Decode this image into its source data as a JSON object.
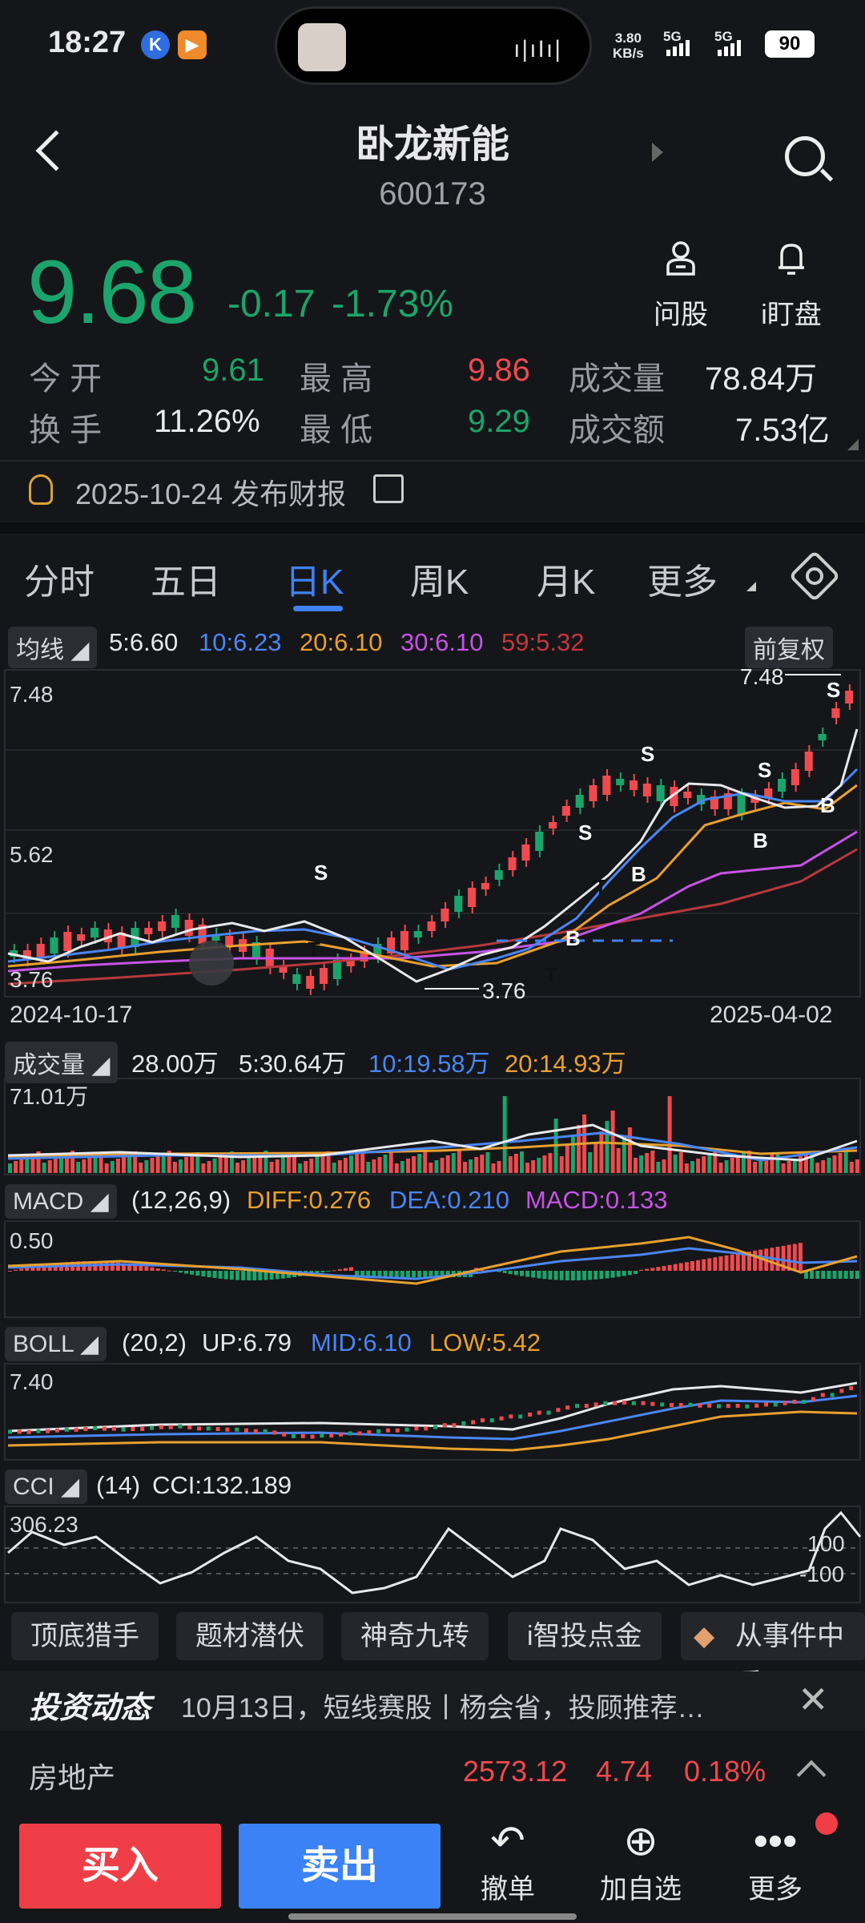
{
  "status_bar": {
    "time": "18:27",
    "speed_top": "3.80",
    "speed_bottom": "KB/s",
    "sig1": "5G",
    "sig2": "5G",
    "battery": "90"
  },
  "header": {
    "stock_name": "卧龙新能",
    "stock_code": "600173"
  },
  "quote": {
    "price": "9.68",
    "change": "-0.17",
    "change_pct": "-1.73%",
    "ask_label": "问股",
    "watch_label": "i盯盘"
  },
  "stats": {
    "open_label": "今  开",
    "open_value": "9.61",
    "high_label": "最  高",
    "high_value": "9.86",
    "volume_label": "成交量",
    "volume_value": "78.84万",
    "turnover_label": "换  手",
    "turnover_value": "11.26%",
    "low_label": "最  低",
    "low_value": "9.29",
    "amount_label": "成交额",
    "amount_value": "7.53亿"
  },
  "report": {
    "text": "2025-10-24 发布财报"
  },
  "tabs": [
    "分时",
    "五日",
    "日K",
    "周K",
    "月K",
    "更多"
  ],
  "ma": {
    "label": "均线",
    "ma5": "5:6.60",
    "ma10": "10:6.23",
    "ma20": "20:6.10",
    "ma30": "30:6.10",
    "ma59": "59:5.32",
    "adjust": "前复权"
  },
  "kline": {
    "y_top": "7.48",
    "y_mid": "5.62",
    "y_low": "3.76",
    "max_marker": "7.48",
    "min_marker": "3.76",
    "date_start": "2024-10-17",
    "date_end": "2025-04-02"
  },
  "volume": {
    "label": "成交量",
    "v": "28.00万",
    "ma5": "5:30.64万",
    "ma10": "10:19.58万",
    "ma20": "20:14.93万",
    "y_top": "71.01万"
  },
  "macd": {
    "label": "MACD",
    "params": "(12,26,9)",
    "diff": "DIFF:0.276",
    "dea": "DEA:0.210",
    "macd": "MACD:0.133",
    "y_top": "0.50"
  },
  "boll": {
    "label": "BOLL",
    "params": "(20,2)",
    "up": "UP:6.79",
    "mid": "MID:6.10",
    "low": "LOW:5.42",
    "y_top": "7.40"
  },
  "cci": {
    "label": "CCI",
    "params": "(14)",
    "value": "CCI:132.189",
    "y_top": "306.23",
    "l1": "100",
    "l2": "-100"
  },
  "chips": [
    "顶底猎手",
    "题材潜伏",
    "神奇九转",
    "i智投点金",
    "从事件中看"
  ],
  "news": {
    "brand": "投资动态",
    "text": "10月13日，短线赛股丨杨会省，投顾推荐…"
  },
  "sector": {
    "name": "房地产",
    "index": "2573.12",
    "change": "4.74",
    "pct": "0.18%"
  },
  "bottom": {
    "buy": "买入",
    "sell": "卖出",
    "cancel": "撤单",
    "add": "加自选",
    "more": "更多"
  },
  "colors": {
    "up": "#ef4a4f",
    "down": "#1ba46b",
    "accent": "#3f82f7",
    "bg": "#151619"
  }
}
